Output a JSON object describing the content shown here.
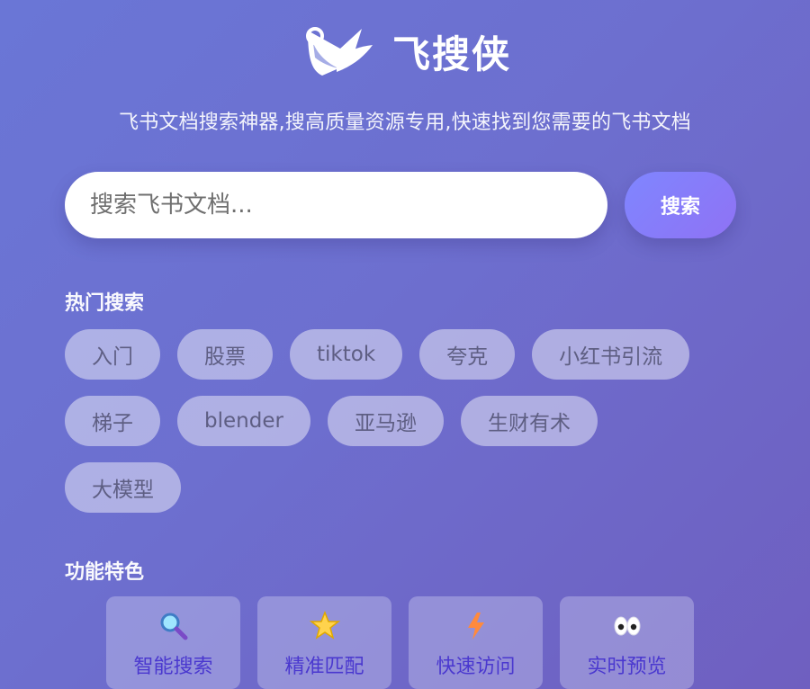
{
  "app": {
    "title": "飞搜侠",
    "subtitle": "飞书文档搜索神器,搜高质量资源专用,快速找到您需要的飞书文档"
  },
  "search": {
    "placeholder": "搜索飞书文档...",
    "value": "",
    "button_label": "搜索"
  },
  "hot": {
    "title": "热门搜索",
    "rows": [
      [
        "入门",
        "股票",
        "tiktok",
        "夸克",
        "小红书引流"
      ],
      [
        "梯子",
        "blender",
        "亚马逊",
        "生财有术"
      ],
      [
        "大模型"
      ]
    ]
  },
  "features": {
    "title": "功能特色",
    "items": [
      {
        "label": "智能搜索",
        "icon": "magnifier-icon"
      },
      {
        "label": "精准匹配",
        "icon": "star-icon"
      },
      {
        "label": "快速访问",
        "icon": "lightning-icon"
      },
      {
        "label": "实时预览",
        "icon": "eyes-icon"
      }
    ]
  },
  "colors": {
    "background_start": "#6a76d6",
    "background_end": "#6f5fc0",
    "button_start": "#7f86ff",
    "button_end": "#8f72f4",
    "feature_text": "#4a38cf"
  }
}
